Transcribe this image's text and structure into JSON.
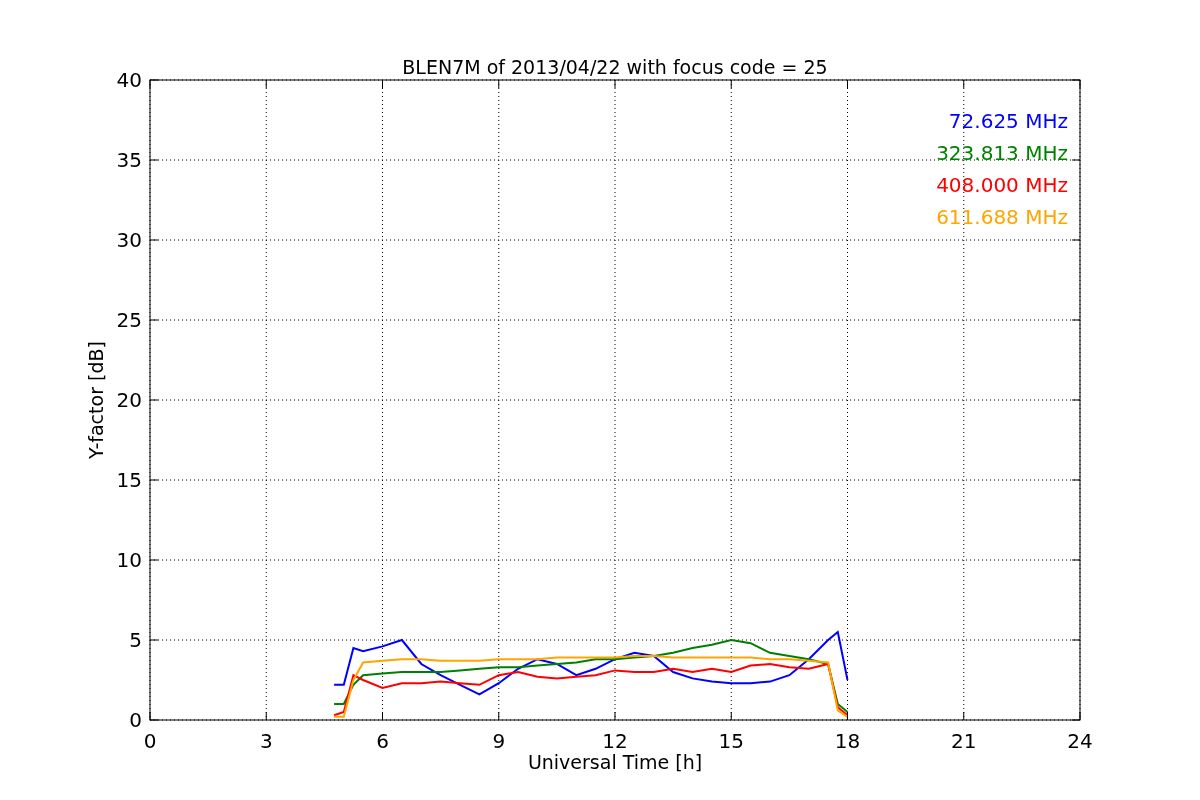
{
  "chart_data": {
    "type": "line",
    "title": "BLEN7M of 2013/04/22 with focus code = 25",
    "xlabel": "Universal Time [h]",
    "ylabel": "Y-factor [dB]",
    "x": [
      4.75,
      5,
      5.25,
      5.5,
      6,
      6.5,
      7,
      7.5,
      8,
      8.5,
      9,
      9.5,
      10,
      10.5,
      11,
      11.5,
      12,
      12.5,
      13,
      13.5,
      14,
      14.5,
      15,
      15.5,
      16,
      16.5,
      17,
      17.5,
      17.75,
      18
    ],
    "series": [
      {
        "name": "72.625 MHz",
        "color": "#0000ff",
        "values": [
          2.2,
          2.2,
          4.5,
          4.3,
          4.6,
          5.0,
          3.5,
          2.8,
          2.2,
          1.6,
          2.3,
          3.2,
          3.8,
          3.5,
          2.8,
          3.2,
          3.8,
          4.2,
          4.0,
          3.0,
          2.6,
          2.4,
          2.3,
          2.3,
          2.4,
          2.8,
          3.8,
          5.0,
          5.5,
          2.5
        ]
      },
      {
        "name": "323.813 MHz",
        "color": "#008000",
        "values": [
          1.0,
          1.0,
          2.2,
          2.8,
          2.9,
          3.0,
          3.0,
          3.0,
          3.1,
          3.2,
          3.3,
          3.3,
          3.4,
          3.5,
          3.6,
          3.8,
          3.8,
          3.9,
          4.0,
          4.2,
          4.5,
          4.7,
          5.0,
          4.8,
          4.2,
          4.0,
          3.8,
          3.5,
          1.0,
          0.5
        ]
      },
      {
        "name": "408.000 MHz",
        "color": "#ff0000",
        "values": [
          0.3,
          0.5,
          2.8,
          2.5,
          2.0,
          2.3,
          2.3,
          2.4,
          2.3,
          2.2,
          2.8,
          3.0,
          2.7,
          2.6,
          2.7,
          2.8,
          3.1,
          3.0,
          3.0,
          3.2,
          3.0,
          3.2,
          3.0,
          3.4,
          3.5,
          3.3,
          3.2,
          3.5,
          0.8,
          0.3
        ]
      },
      {
        "name": "611.688 MHz",
        "color": "#ffa500",
        "values": [
          0.2,
          0.2,
          2.5,
          3.6,
          3.7,
          3.8,
          3.8,
          3.7,
          3.7,
          3.7,
          3.8,
          3.8,
          3.8,
          3.9,
          3.9,
          3.9,
          3.9,
          4.0,
          4.0,
          3.9,
          3.9,
          3.9,
          3.9,
          3.9,
          3.8,
          3.8,
          3.7,
          3.6,
          0.6,
          0.2
        ]
      }
    ],
    "grid": true,
    "xlim": [
      0,
      24
    ],
    "ylim": [
      0,
      40
    ],
    "xticks": [
      0,
      3,
      6,
      9,
      12,
      15,
      18,
      21,
      24
    ],
    "yticks": [
      0,
      5,
      10,
      15,
      20,
      25,
      30,
      35,
      40
    ]
  }
}
